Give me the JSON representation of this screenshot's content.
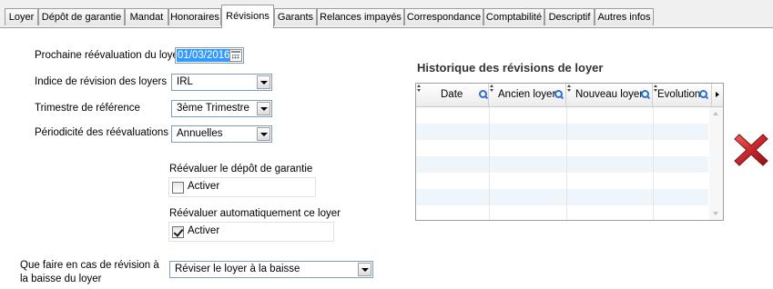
{
  "tabs": [
    {
      "label": "Loyer"
    },
    {
      "label": "Dépôt de garantie"
    },
    {
      "label": "Mandat"
    },
    {
      "label": "Honoraires"
    },
    {
      "label": "Révisions"
    },
    {
      "label": "Garants"
    },
    {
      "label": "Relances impayés"
    },
    {
      "label": "Correspondance"
    },
    {
      "label": "Comptabilité"
    },
    {
      "label": "Descriptif"
    },
    {
      "label": "Autres infos"
    }
  ],
  "active_tab": "Révisions",
  "form": {
    "next_revaluation": {
      "label": "Prochaine réévaluation du loyer",
      "value": "01/03/2016"
    },
    "index": {
      "label": "Indice de révision des loyers",
      "value": "IRL"
    },
    "quarter": {
      "label": "Trimestre de référence",
      "value": "3ème Trimestre"
    },
    "periodicity": {
      "label": "Périodicité des réévaluations",
      "value": "Annuelles"
    },
    "deposit_revaluation": {
      "label": "Réévaluer le dépôt de garantie",
      "checkbox_label": "Activer",
      "checked": false
    },
    "auto_revaluation": {
      "label": "Réévaluer automatiquement ce loyer",
      "checkbox_label": "Activer",
      "checked": true
    },
    "downward_revision": {
      "label_line1": "Que faire en cas de révision à",
      "label_line2": "la baisse du loyer",
      "value": "Réviser le loyer à la baisse"
    }
  },
  "history": {
    "title": "Historique des révisions de loyer",
    "columns": [
      {
        "label": "Date"
      },
      {
        "label": "Ancien loyer"
      },
      {
        "label": "Nouveau loyer"
      },
      {
        "label": "Evolution"
      }
    ],
    "rows": []
  },
  "icons": {
    "delete": "delete-x-icon",
    "calendar": "calendar-icon",
    "column_search": "magnifier-icon"
  },
  "colors": {
    "selection": "#3399ff",
    "delete_red": "#c8262b",
    "row_alt": "#eef6fc"
  }
}
